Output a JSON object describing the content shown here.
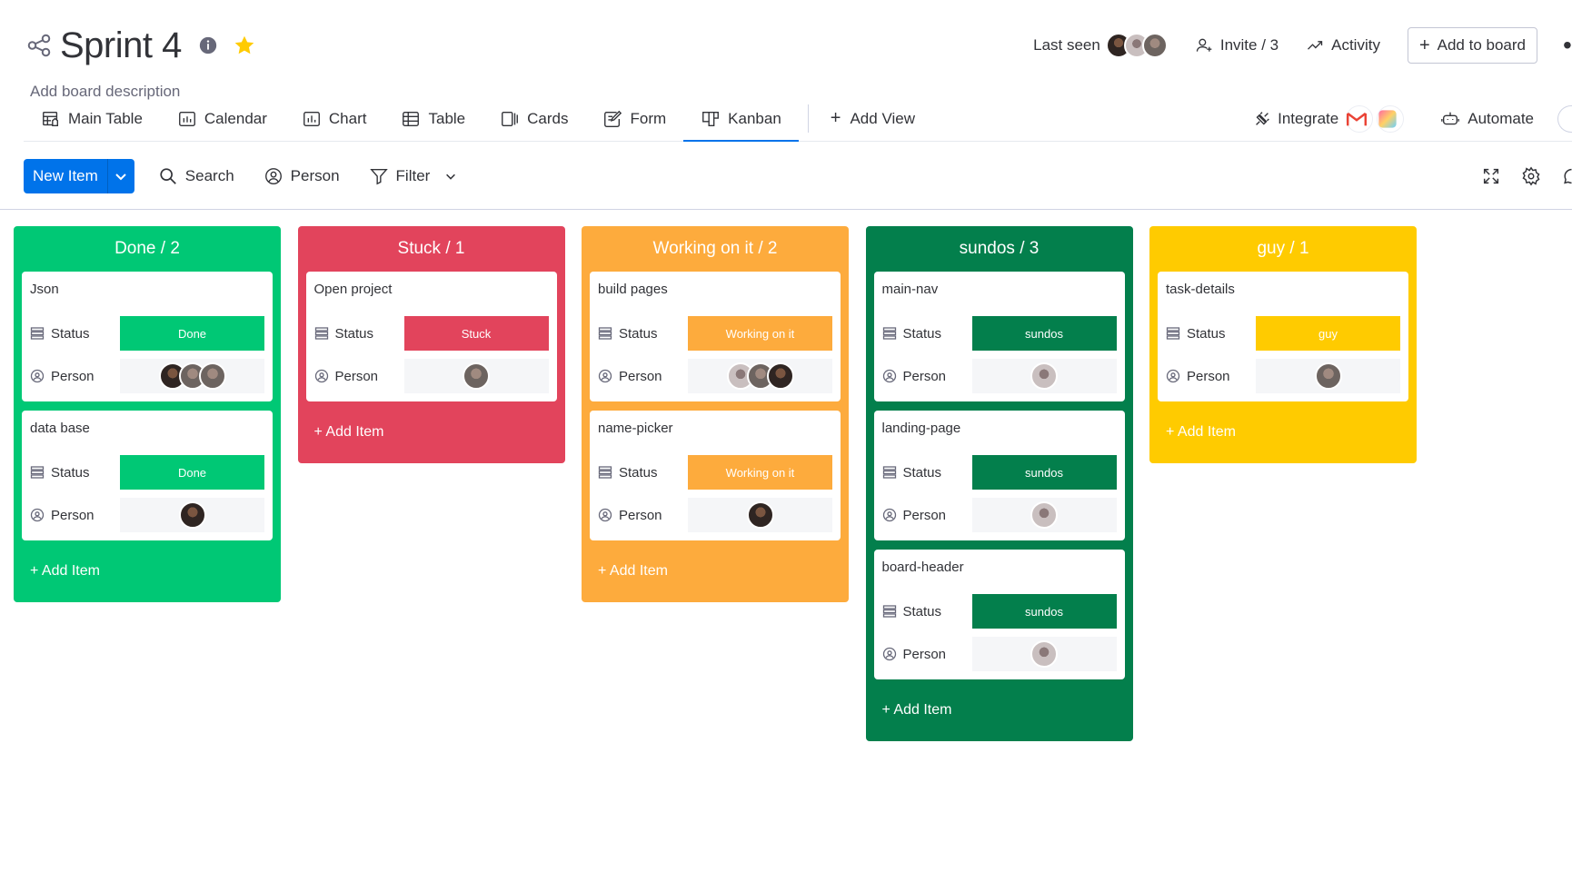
{
  "board": {
    "title": "Sprint 4",
    "description": "Add board description"
  },
  "header": {
    "last_seen_label": "Last seen",
    "invite_label": "Invite / 3",
    "activity_label": "Activity",
    "add_to_board_label": "Add to board"
  },
  "tabs": [
    {
      "label": "Main Table",
      "icon": "main-table-icon"
    },
    {
      "label": "Calendar",
      "icon": "calendar-icon"
    },
    {
      "label": "Chart",
      "icon": "chart-icon"
    },
    {
      "label": "Table",
      "icon": "table-icon"
    },
    {
      "label": "Cards",
      "icon": "cards-icon"
    },
    {
      "label": "Form",
      "icon": "form-icon"
    },
    {
      "label": "Kanban",
      "icon": "kanban-icon",
      "active": true
    }
  ],
  "add_view_label": "Add View",
  "integrate_label": "Integrate",
  "automate_label": "Automate",
  "toolbar": {
    "new_item_label": "New Item",
    "search_label": "Search",
    "person_label": "Person",
    "filter_label": "Filter"
  },
  "field_labels": {
    "status": "Status",
    "person": "Person"
  },
  "add_item_label": "+ Add Item",
  "colors": {
    "done": "#00c875",
    "stuck": "#e2445c",
    "working": "#fdab3d",
    "sundos": "#037f4c",
    "guy": "#ffcb00",
    "primary": "#0073ea"
  },
  "columns": [
    {
      "title": "Done / 2",
      "color": "#00c875",
      "cards": [
        {
          "name": "Json",
          "status": "Done",
          "status_color": "#00c875",
          "people": [
            "dark",
            "grey",
            "grey"
          ]
        },
        {
          "name": "data base",
          "status": "Done",
          "status_color": "#00c875",
          "people": [
            "dark"
          ]
        }
      ]
    },
    {
      "title": "Stuck / 1",
      "color": "#e2445c",
      "cards": [
        {
          "name": "Open project",
          "status": "Stuck",
          "status_color": "#e2445c",
          "people": [
            "grey"
          ]
        }
      ]
    },
    {
      "title": "Working on it / 2",
      "color": "#fdab3d",
      "cards": [
        {
          "name": "build pages",
          "status": "Working on it",
          "status_color": "#fdab3d",
          "people": [
            "pink",
            "grey",
            "dark"
          ]
        },
        {
          "name": "name-picker",
          "status": "Working on it",
          "status_color": "#fdab3d",
          "people": [
            "dark"
          ]
        }
      ]
    },
    {
      "title": "sundos / 3",
      "color": "#037f4c",
      "cards": [
        {
          "name": "main-nav",
          "status": "sundos",
          "status_color": "#037f4c",
          "people": [
            "pink"
          ]
        },
        {
          "name": "landing-page",
          "status": "sundos",
          "status_color": "#037f4c",
          "people": [
            "pink"
          ]
        },
        {
          "name": "board-header",
          "status": "sundos",
          "status_color": "#037f4c",
          "people": [
            "pink"
          ]
        }
      ]
    },
    {
      "title": "guy / 1",
      "color": "#ffcb00",
      "cards": [
        {
          "name": "task-details",
          "status": "guy",
          "status_color": "#ffcb00",
          "people": [
            "grey"
          ]
        }
      ]
    }
  ]
}
